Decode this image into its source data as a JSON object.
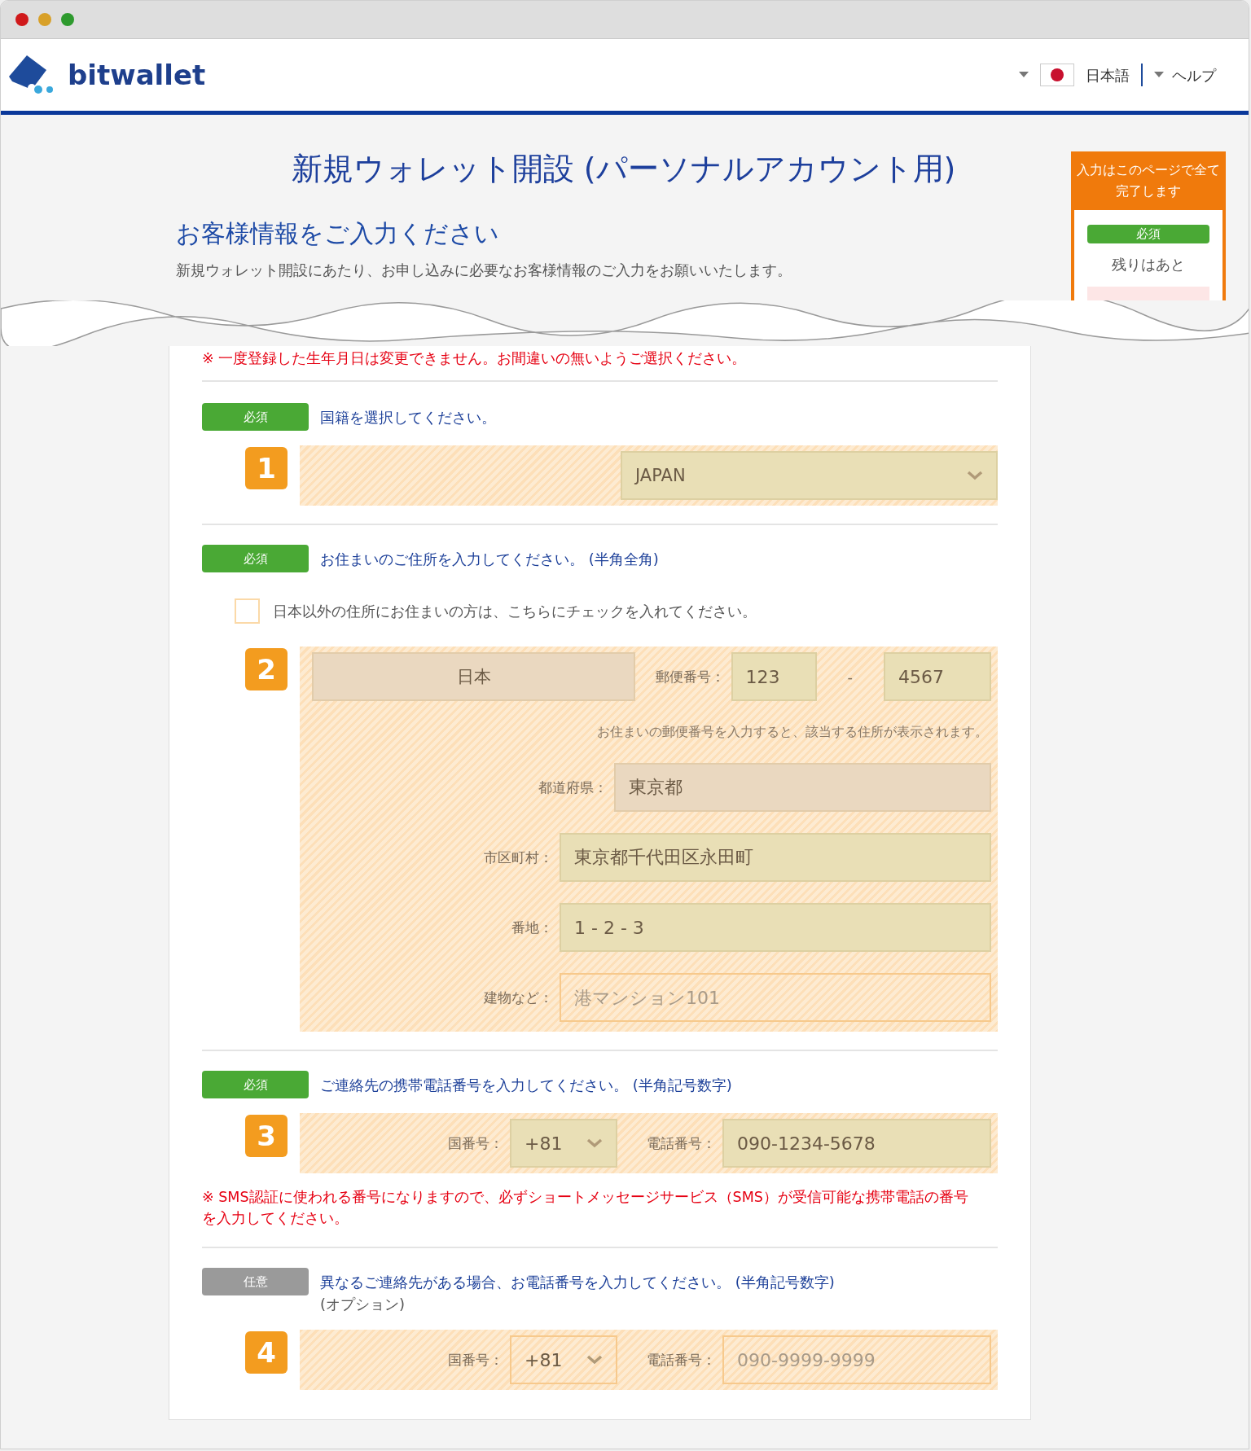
{
  "header": {
    "logo_text": "bitwallet",
    "language": "日本語",
    "help": "ヘルプ"
  },
  "page_title": "新規ウォレット開設 (パーソナルアカウント用)",
  "section_title": "お客様情報をご入力ください",
  "intro": "新規ウォレット開設にあたり、お申し込みに必要なお客様情報のご入力をお願いいたします。",
  "sidebar": {
    "heading": "入力はこのページで全て完了します",
    "badge": "必須",
    "remaining": "残りはあと"
  },
  "notice": "※ 一度登録した生年月日は変更できません。お間違いの無いようご選択ください。",
  "steps": [
    {
      "badge": {
        "label": "必須",
        "kind": "required"
      },
      "prompt": "国籍を選択してください。",
      "number": "1",
      "rows": [
        {
          "kind": "select",
          "value": "JAPAN",
          "filled": true
        }
      ]
    },
    {
      "badge": {
        "label": "必須",
        "kind": "required"
      },
      "prompt": "お住まいのご住所を入力してください。 (半角全角)",
      "checkbox": {
        "label": "日本以外の住所にお住まいの方は、こちらにチェックを入れてください。",
        "checked": false
      },
      "number": "2",
      "rows": [
        {
          "kind": "postal",
          "country": "日本",
          "label": "郵便番号：",
          "first": {
            "value": "123",
            "filled": true
          },
          "dash": "-",
          "second": {
            "value": "4567",
            "filled": true
          }
        },
        {
          "kind": "hint",
          "text": "お住まいの郵便番号を入力すると、該当する住所が表示されます。"
        },
        {
          "kind": "address",
          "label": "都道府県：",
          "field": {
            "value": "東京都",
            "readonly": true,
            "filled": true
          }
        },
        {
          "kind": "address",
          "label": "市区町村：",
          "field": {
            "value": "東京都千代田区永田町",
            "readonly": false,
            "filled": true
          }
        },
        {
          "kind": "address",
          "label": "番地：",
          "field": {
            "value": "1 - 2 - 3",
            "readonly": false,
            "filled": true
          }
        },
        {
          "kind": "address",
          "label": "建物など：",
          "field": {
            "placeholder": "港マンション101",
            "readonly": false,
            "filled": false
          }
        }
      ]
    },
    {
      "badge": {
        "label": "必須",
        "kind": "required"
      },
      "prompt": "ご連絡先の携帯電話番号を入力してください。 (半角記号数字)",
      "number": "3",
      "rows": [
        {
          "kind": "phone",
          "code_label": "国番号：",
          "code": {
            "value": "+81",
            "filled": true
          },
          "number_label": "電話番号：",
          "phone": {
            "value": "090-1234-5678",
            "filled": true
          }
        }
      ],
      "note": "※ SMS認証に使われる番号になりますので、必ずショートメッセージサービス（SMS）が受信可能な携帯電話の番号を入力してください。"
    },
    {
      "badge": {
        "label": "任意",
        "kind": "optional"
      },
      "prompt": "異なるご連絡先がある場合、お電話番号を入力してください。 (半角記号数字)",
      "prompt_extra": "(オプション)",
      "number": "4",
      "rows": [
        {
          "kind": "phone",
          "code_label": "国番号：",
          "code": {
            "value": "+81",
            "filled": false
          },
          "number_label": "電話番号：",
          "phone": {
            "placeholder": "090-9999-9999",
            "filled": false
          }
        }
      ]
    }
  ]
}
